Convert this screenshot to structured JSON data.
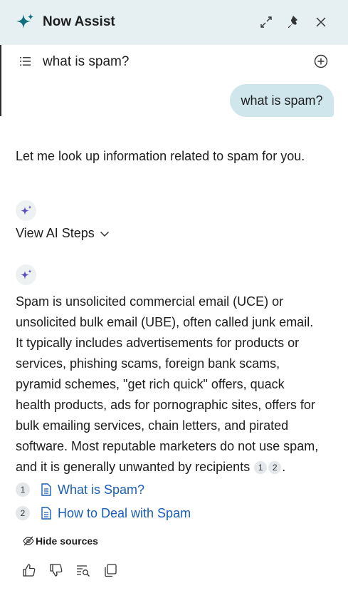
{
  "header": {
    "title": "Now Assist",
    "icons": [
      "sparkle-logo-icon",
      "expand-icon",
      "pin-icon",
      "close-icon"
    ]
  },
  "conversation": {
    "title": "what is spam?",
    "icons": [
      "menu-icon",
      "new-chat-icon"
    ]
  },
  "user_message": "what is spam?",
  "assistant": {
    "intro": "Let me look up information related to spam for you.",
    "steps_label": "View AI Steps",
    "answer_lines": [
      "Spam is unsolicited commercial email (UCE) or",
      "unsolicited bulk email (UBE), often called junk email.",
      "It typically includes advertisements for products or",
      "services, phishing scams, foreign bank scams,",
      "pyramid schemes, \"get rich quick\" offers, quack",
      "health products, ads for pornographic sites, offers for",
      "bulk emailing services, chain letters, and pirated",
      "software. Most reputable marketers do not use spam,",
      "and it is generally unwanted by recipients"
    ],
    "citations": [
      "1",
      "2"
    ],
    "answer_end": "."
  },
  "sources": [
    {
      "num": "1",
      "title": "What is Spam?"
    },
    {
      "num": "2",
      "title": "How to Deal with Spam"
    }
  ],
  "hide_sources_label": "Hide sources",
  "feedback_icons": [
    "thumbs-up-icon",
    "thumbs-down-icon",
    "search-list-icon",
    "copy-icon"
  ],
  "colors": {
    "header_bg": "#e6f0f3",
    "user_bubble": "#cfe6ec",
    "link": "#1a5db5",
    "sparkle": "#5b4dbf"
  }
}
